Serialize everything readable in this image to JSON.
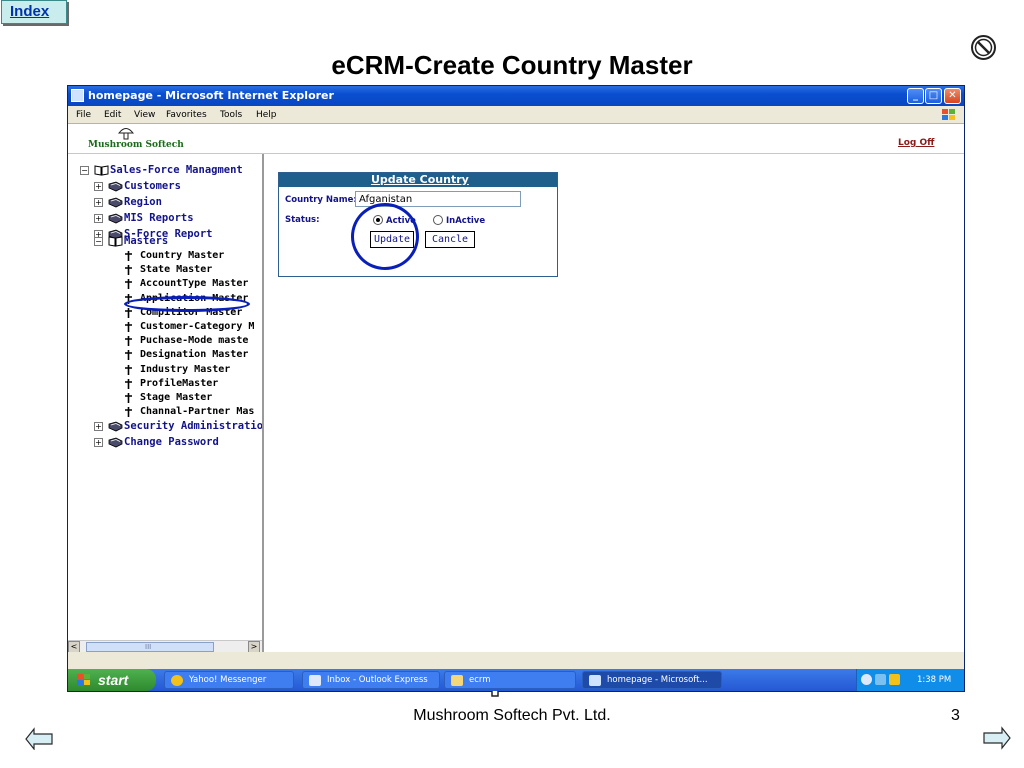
{
  "slide": {
    "index_label": "Index",
    "title": "eCRM-Create Country Master",
    "footer": "Mushroom Softech Pvt. Ltd.",
    "page_number": "3"
  },
  "window": {
    "title": "homepage - Microsoft Internet Explorer",
    "menu": [
      "File",
      "Edit",
      "View",
      "Favorites",
      "Tools",
      "Help"
    ]
  },
  "app": {
    "brand": "Mushroom Softech",
    "logoff": "Log Off"
  },
  "tree": {
    "root": "Sales-Force Managment",
    "groups_before": [
      "Customers",
      "Region",
      "MIS Reports",
      "S-Force Report"
    ],
    "masters_label": "Masters",
    "masters_items": [
      "Country Master",
      "State Master",
      "AccountType Master",
      "Application Master",
      "Compititor Master",
      "Customer-Category M",
      "Puchase-Mode maste",
      "Designation Master",
      "Industry Master",
      "ProfileMaster",
      "Stage Master",
      "Channal-Partner Mas"
    ],
    "groups_after": [
      "Security Administration",
      "Change Password"
    ],
    "scroll_left": "<",
    "scroll_right": ">",
    "scroll_grip": "III"
  },
  "form": {
    "header": "Update Country",
    "country_name_label": "Country Name:",
    "country_name_value": "Afganistan",
    "status_label": "Status:",
    "status_options": [
      "Active",
      "InActive"
    ],
    "selected_status": "Active",
    "update_button": "Update",
    "cancel_button": "Cancle"
  },
  "taskbar": {
    "start": "start",
    "tasks": [
      "Yahoo! Messenger",
      "Inbox - Outlook Express",
      "ecrm",
      "homepage - Microsoft..."
    ],
    "clock": "1:38 PM"
  },
  "colors": {
    "titlebar_blue": "#0a4fd0",
    "form_header": "#1f5f8c",
    "tree_text": "#13138b",
    "annotation": "#0a1fb8",
    "logoff": "#8b1a1a"
  }
}
